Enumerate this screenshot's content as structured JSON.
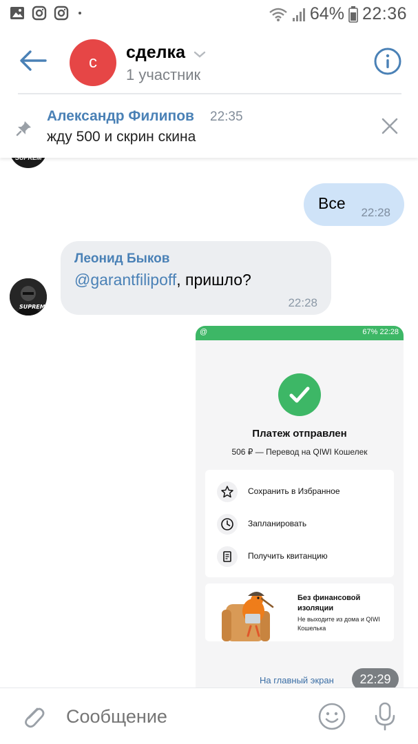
{
  "status_bar": {
    "battery": "64%",
    "time": "22:36",
    "left_icons": [
      "gallery-icon",
      "instagram-icon",
      "instagram-icon",
      "dot-icon"
    ],
    "right_icons": [
      "wifi-icon",
      "signal-icon",
      "battery-icon"
    ]
  },
  "header": {
    "avatar_letter": "с",
    "avatar_color": "#e64646",
    "title": "сделка",
    "subtitle": "1 участник"
  },
  "pinned": {
    "author": "Александр Филипов",
    "time": "22:35",
    "text": "жду 500 и скрин скина"
  },
  "messages": {
    "outgoing": {
      "text": "Все",
      "time": "22:28"
    },
    "incoming": {
      "author": "Леонид Быков",
      "mention": "@garantfilipoff",
      "text": ", пришло?",
      "time": "22:28"
    },
    "screenshot": {
      "status_left": "@",
      "status_right": "67% 22:28",
      "title": "Платеж отправлен",
      "subtitle": "506 ₽ — Перевод на QIWI Кошелек",
      "actions": [
        {
          "label": "Сохранить в Избранное",
          "icon": "star-icon"
        },
        {
          "label": "Запланировать",
          "icon": "clock-icon"
        },
        {
          "label": "Получить квитанцию",
          "icon": "receipt-icon"
        }
      ],
      "promo_title": "Без финансовой изоляции",
      "promo_text": "Не выходите из дома и QIWI Кошелька",
      "home_link": "На главный экран",
      "time": "22:29"
    }
  },
  "input": {
    "placeholder": "Сообщение"
  },
  "colors": {
    "accent": "#4a81b6",
    "outgoing_bubble": "#cfe3f8",
    "incoming_bubble": "#eceef1",
    "qiwi_green": "#3db766"
  }
}
